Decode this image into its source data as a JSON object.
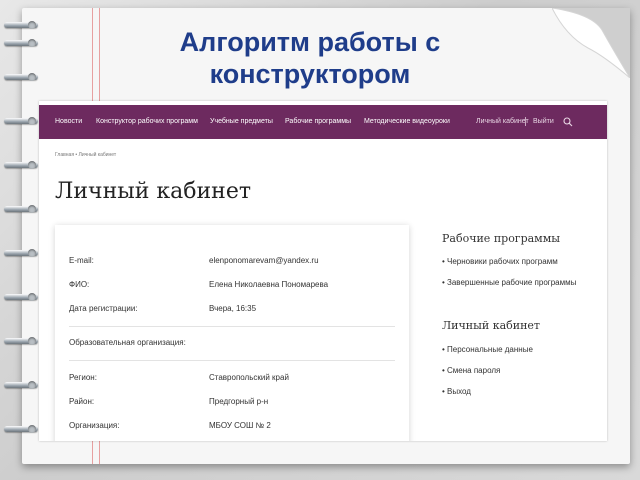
{
  "slide": {
    "title": "Алгоритм работы с конструктором"
  },
  "nav": {
    "items": [
      "Новости",
      "Конструктор рабочих программ",
      "Учебные предметы",
      "Рабочие программы",
      "Методические видеоуроки"
    ],
    "account": "Личный кабинет",
    "logout": "Выйти"
  },
  "breadcrumb": "Главная  •  Личный кабинет",
  "page": {
    "title": "Личный кабинет"
  },
  "profile": {
    "email_label": "E-mail:",
    "email": "elenponomarevam@yandex.ru",
    "fio_label": "ФИО:",
    "fio": "Елена Николаевна Пономарева",
    "reg_label": "Дата регистрации:",
    "reg": "Вчера, 16:35",
    "org_section": "Образовательная организация:",
    "region_label": "Регион:",
    "region": "Ставропольский край",
    "district_label": "Район:",
    "district": "Предгорный р-н",
    "org_label": "Организация:",
    "org": "МБОУ СОШ № 2"
  },
  "sidebar": {
    "programs_title": "Рабочие программы",
    "programs": [
      "• Черновики рабочих программ",
      "• Завершенные рабочие программы"
    ],
    "account_title": "Личный кабинет",
    "account": [
      "• Персональные данные",
      "• Смена пароля",
      "• Выход"
    ]
  },
  "colors": {
    "nav": "#6d2a5f",
    "title": "#1f3d8a"
  }
}
